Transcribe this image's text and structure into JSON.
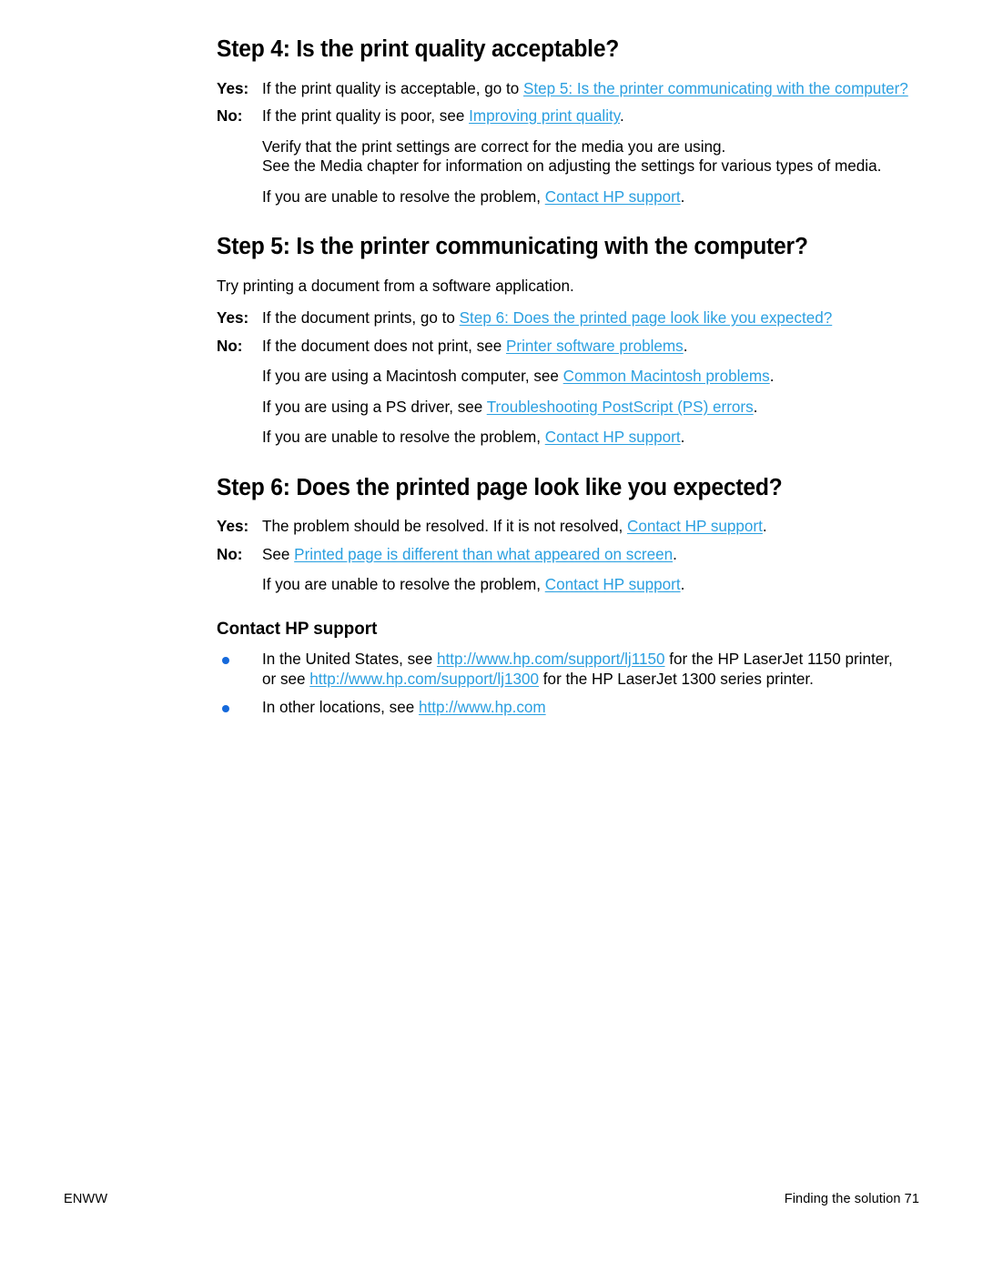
{
  "page": {
    "footer_left": "ENWW",
    "footer_right": "Finding the solution 71",
    "link_color": "#2a9fe0",
    "bullet_color": "#1569db",
    "text_color": "#000000",
    "background": "#ffffff"
  },
  "step4": {
    "heading": "Step 4: Is the print quality acceptable?",
    "yes_label": "Yes",
    "yes_colon": ":",
    "yes_text_before": "If the print quality is acceptable, go to ",
    "yes_link": "Step 5: Is the printer communicating with the computer?",
    "no_label": "No",
    "no_colon": ":",
    "no_text_before": "If the print quality is poor, see ",
    "no_link": "Improving print quality",
    "no_text_after": ".",
    "verify_line": "Verify that the print settings are correct for the media you are using.",
    "media_line": "See the Media chapter for information on adjusting the settings for various types of media.",
    "unable_before": "If you are unable to resolve the problem, ",
    "unable_link": "Contact HP support",
    "unable_after": "."
  },
  "step5": {
    "heading": "Step 5: Is the printer communicating with the computer?",
    "intro": "Try printing a document from a software application.",
    "yes_label": "Yes",
    "yes_colon": ":",
    "yes_text_before": "If the document prints, go to ",
    "yes_link": "Step 6: Does the printed page look like you expected?",
    "no_label": "No",
    "no_colon": ":",
    "no_text_before": "If the document does not print, see ",
    "no_link": "Printer software problems",
    "no_text_after": ".",
    "mac_before": "If you are using a Macintosh computer, see ",
    "mac_link": "Common Macintosh problems",
    "mac_after": ".",
    "ps_before": "If you are using a PS driver, see ",
    "ps_link": "Troubleshooting PostScript (PS) errors",
    "ps_after": ".",
    "unable_before": "If you are unable to resolve the problem, ",
    "unable_link": "Contact HP support",
    "unable_after": "."
  },
  "step6": {
    "heading": "Step 6: Does the printed page look like you expected?",
    "yes_label": "Yes",
    "yes_colon": ":",
    "yes_text_before": "The problem should be resolved. If it is not resolved, ",
    "yes_link": "Contact HP support",
    "yes_text_after": ".",
    "no_label": "No",
    "no_colon": ":",
    "no_text_before": "See ",
    "no_link": "Printed page is different than what appeared on screen",
    "no_text_after": ".",
    "unable_before": "If you are unable to resolve the problem, ",
    "unable_link": "Contact HP support",
    "unable_after": "."
  },
  "contact": {
    "heading": "Contact HP support",
    "bullet1_before": "In the United States, see ",
    "bullet1_link1": "http://www.hp.com/support/lj1150",
    "bullet1_mid": " for the HP LaserJet 1150 printer, or see  ",
    "bullet1_link2": "http://www.hp.com/support/lj1300",
    "bullet1_after": " for the HP LaserJet 1300 series printer.",
    "bullet2_before": "In other locations, see ",
    "bullet2_link": "http://www.hp.com",
    "bullet2_after": ""
  }
}
